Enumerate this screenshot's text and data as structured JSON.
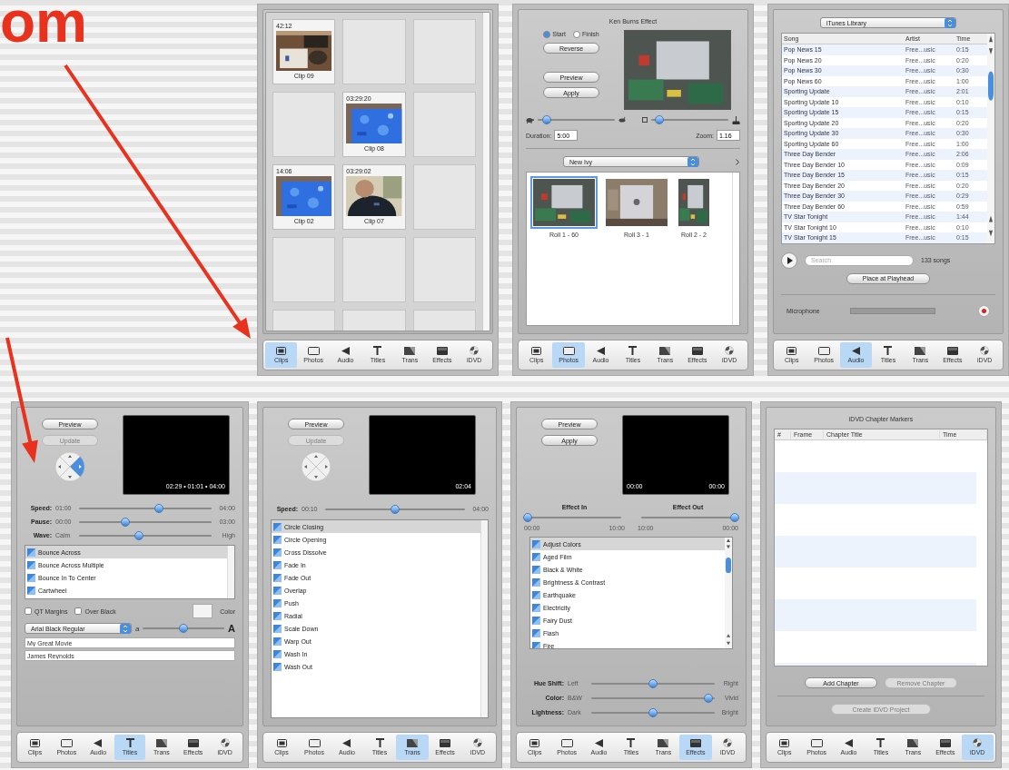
{
  "heading": "om",
  "panels": [
    {
      "kind": "clips",
      "cells": [
        {
          "kind": "clip",
          "time": "42:12",
          "name": "Clip 09"
        },
        {
          "kind": "empty"
        },
        {
          "kind": "empty"
        },
        {
          "kind": "empty"
        },
        {
          "kind": "clip",
          "time": "03:29:20",
          "name": "Clip 08"
        },
        {
          "kind": "empty"
        },
        {
          "kind": "clip",
          "time": "14:06",
          "name": "Clip 02"
        },
        {
          "kind": "clip",
          "time": "03:29:02",
          "name": "Clip 07"
        },
        {
          "kind": "empty"
        },
        {
          "kind": "empty"
        },
        {
          "kind": "empty"
        },
        {
          "kind": "empty"
        },
        {
          "kind": "empty"
        },
        {
          "kind": "empty"
        },
        {
          "kind": "empty"
        }
      ],
      "toolbar": [
        {
          "label": "Clips",
          "selected": true
        },
        {
          "label": "Photos",
          "selected": false
        },
        {
          "label": "Audio",
          "selected": false
        },
        {
          "label": "Titles",
          "selected": false
        },
        {
          "label": "Trans",
          "selected": false
        },
        {
          "label": "Effects",
          "selected": false
        },
        {
          "label": "iDVD",
          "selected": false
        }
      ]
    },
    {
      "kind": "photos",
      "title": "Ken Burns Effect",
      "radios": [
        {
          "label": "Start",
          "selected": true
        },
        {
          "label": "Finish",
          "selected": false
        }
      ],
      "buttons": [
        {
          "label": "Reverse",
          "disabled": false
        },
        {
          "label": "Preview",
          "disabled": false
        },
        {
          "label": "Apply",
          "disabled": false
        }
      ],
      "sliders": [
        {
          "level": 0.12
        },
        {
          "level": 0.1
        }
      ],
      "fields": [
        {
          "label": "Duration:",
          "value": "5:00"
        },
        {
          "label": "Zoom:",
          "value": "1.16"
        }
      ],
      "album": "New Ivy",
      "photos": [
        {
          "name": "Roll 1 - 60",
          "selected": true
        },
        {
          "name": "Roll 3 - 1",
          "selected": false
        },
        {
          "name": "Roll 2 - 2",
          "selected": false
        }
      ],
      "toolbar": [
        {
          "label": "Clips",
          "selected": false
        },
        {
          "label": "Photos",
          "selected": true
        },
        {
          "label": "Audio",
          "selected": false
        },
        {
          "label": "Titles",
          "selected": false
        },
        {
          "label": "Trans",
          "selected": false
        },
        {
          "label": "Effects",
          "selected": false
        },
        {
          "label": "iDVD",
          "selected": false
        }
      ]
    },
    {
      "kind": "audio",
      "source": "iTunes Library",
      "columns": [
        "Song",
        "Artist",
        "Time"
      ],
      "rows": [
        {
          "song": "Pop News 15",
          "artist": "Free...usic",
          "time": "0:15"
        },
        {
          "song": "Pop News 20",
          "artist": "Free...usic",
          "time": "0:20"
        },
        {
          "song": "Pop News 30",
          "artist": "Free...usic",
          "time": "0:30"
        },
        {
          "song": "Pop News 60",
          "artist": "Free...usic",
          "time": "1:00"
        },
        {
          "song": "Sporting Update",
          "artist": "Free...usic",
          "time": "2:01"
        },
        {
          "song": "Sporting Update 10",
          "artist": "Free...usic",
          "time": "0:10"
        },
        {
          "song": "Sporting Update 15",
          "artist": "Free...usic",
          "time": "0:15"
        },
        {
          "song": "Sporting Update 20",
          "artist": "Free...usic",
          "time": "0:20"
        },
        {
          "song": "Sporting Update 30",
          "artist": "Free...usic",
          "time": "0:30"
        },
        {
          "song": "Sporting Update 60",
          "artist": "Free...usic",
          "time": "1:00"
        },
        {
          "song": "Three Day Bender",
          "artist": "Free...usic",
          "time": "2:06"
        },
        {
          "song": "Three Day Bender 10",
          "artist": "Free...usic",
          "time": "0:09"
        },
        {
          "song": "Three Day Bender 15",
          "artist": "Free...usic",
          "time": "0:15"
        },
        {
          "song": "Three Day Bender 20",
          "artist": "Free...usic",
          "time": "0:20"
        },
        {
          "song": "Three Day Bender 30",
          "artist": "Free...usic",
          "time": "0:29"
        },
        {
          "song": "Three Day Bender 60",
          "artist": "Free...usic",
          "time": "0:59"
        },
        {
          "song": "TV Star Tonight",
          "artist": "Free...usic",
          "time": "1:44"
        },
        {
          "song": "TV Star Tonight 10",
          "artist": "Free...usic",
          "time": "0:10"
        },
        {
          "song": "TV Star Tonight 15",
          "artist": "Free...usic",
          "time": "0:15"
        }
      ],
      "search": {
        "placeholder": "Search"
      },
      "count": "133 songs",
      "button": "Place at Playhead",
      "mic_label": "Microphone",
      "toolbar": [
        {
          "label": "Clips",
          "selected": false
        },
        {
          "label": "Photos",
          "selected": false
        },
        {
          "label": "Audio",
          "selected": true
        },
        {
          "label": "Titles",
          "selected": false
        },
        {
          "label": "Trans",
          "selected": false
        },
        {
          "label": "Effects",
          "selected": false
        },
        {
          "label": "iDVD",
          "selected": false
        }
      ]
    },
    {
      "kind": "titles",
      "buttons": [
        {
          "label": "Preview",
          "disabled": false
        },
        {
          "label": "Update",
          "disabled": true
        }
      ],
      "wheel": [
        {
          "selected": false
        },
        {
          "selected": true
        },
        {
          "selected": false
        },
        {
          "selected": false
        }
      ],
      "preview_time": "02:29 • 01:01 • 04:00",
      "sliders": [
        {
          "label": "Speed:",
          "min": "01:00",
          "max": "04:00",
          "level": 0.6
        },
        {
          "label": "Pause:",
          "min": "00:00",
          "max": "03:00",
          "level": 0.35
        },
        {
          "label": "Wave:",
          "min": "Calm",
          "max": "High",
          "level": 0.45
        }
      ],
      "items": [
        {
          "label": "Bounce Across",
          "selected": true
        },
        {
          "label": "Bounce Across Multiple",
          "selected": false
        },
        {
          "label": "Bounce In To Center",
          "selected": false
        },
        {
          "label": "Cartwheel",
          "selected": false
        }
      ],
      "options": [
        {
          "label": "QT Margins",
          "checked": false
        },
        {
          "label": "Over Black",
          "checked": false
        }
      ],
      "color_label": "Color",
      "font": "Arial Black Regular",
      "size_slider": {
        "min": "a",
        "max": "A",
        "level": 0.5
      },
      "texts": [
        "My Great Movie",
        "James Reynolds"
      ],
      "toolbar": [
        {
          "label": "Clips",
          "selected": false
        },
        {
          "label": "Photos",
          "selected": false
        },
        {
          "label": "Audio",
          "selected": false
        },
        {
          "label": "Titles",
          "selected": true
        },
        {
          "label": "Trans",
          "selected": false
        },
        {
          "label": "Effects",
          "selected": false
        },
        {
          "label": "iDVD",
          "selected": false
        }
      ]
    },
    {
      "kind": "trans",
      "buttons": [
        {
          "label": "Preview",
          "disabled": false
        },
        {
          "label": "Update",
          "disabled": true
        }
      ],
      "wheel": [
        {
          "selected": false
        },
        {
          "selected": false
        },
        {
          "selected": false
        },
        {
          "selected": false
        }
      ],
      "preview_time": "02:04",
      "sliders": [
        {
          "label": "Speed:",
          "min": "00:10",
          "max": "04:00",
          "level": 0.5
        }
      ],
      "items": [
        {
          "label": "Circle Closing",
          "selected": true
        },
        {
          "label": "Circle Opening",
          "selected": false
        },
        {
          "label": "Cross Dissolve",
          "selected": false
        },
        {
          "label": "Fade In",
          "selected": false
        },
        {
          "label": "Fade Out",
          "selected": false
        },
        {
          "label": "Overlap",
          "selected": false
        },
        {
          "label": "Push",
          "selected": false
        },
        {
          "label": "Radial",
          "selected": false
        },
        {
          "label": "Scale Down",
          "selected": false
        },
        {
          "label": "Warp Out",
          "selected": false
        },
        {
          "label": "Wash In",
          "selected": false
        },
        {
          "label": "Wash Out",
          "selected": false
        }
      ],
      "toolbar": [
        {
          "label": "Clips",
          "selected": false
        },
        {
          "label": "Photos",
          "selected": false
        },
        {
          "label": "Audio",
          "selected": false
        },
        {
          "label": "Titles",
          "selected": false
        },
        {
          "label": "Trans",
          "selected": true
        },
        {
          "label": "Effects",
          "selected": false
        },
        {
          "label": "iDVD",
          "selected": false
        }
      ]
    },
    {
      "kind": "effects",
      "buttons": [
        {
          "label": "Preview",
          "disabled": false
        },
        {
          "label": "Apply",
          "disabled": false
        }
      ],
      "preview_times": [
        "00:00",
        "00:00"
      ],
      "effect_sliders": [
        {
          "label": "Effect In",
          "min": "00:00",
          "max": "10:00",
          "level": 0
        },
        {
          "label": "Effect Out",
          "min": "10:00",
          "max": "00:00",
          "level": 1
        }
      ],
      "items": [
        {
          "label": "Adjust Colors",
          "selected": true
        },
        {
          "label": "Aged Film",
          "selected": false
        },
        {
          "label": "Black & White",
          "selected": false
        },
        {
          "label": "Brightness & Contrast",
          "selected": false
        },
        {
          "label": "Earthquake",
          "selected": false
        },
        {
          "label": "Electricity",
          "selected": false
        },
        {
          "label": "Fairy Dust",
          "selected": false
        },
        {
          "label": "Flash",
          "selected": false
        },
        {
          "label": "Fire",
          "selected": false
        }
      ],
      "sliders": [
        {
          "label": "Hue Shift:",
          "min": "Left",
          "max": "Right",
          "level": 0.5
        },
        {
          "label": "Color:",
          "min": "B&W",
          "max": "Vivid",
          "level": 0.95
        },
        {
          "label": "Lightness:",
          "min": "Dark",
          "max": "Bright",
          "level": 0.5
        }
      ],
      "toolbar": [
        {
          "label": "Clips",
          "selected": false
        },
        {
          "label": "Photos",
          "selected": false
        },
        {
          "label": "Audio",
          "selected": false
        },
        {
          "label": "Titles",
          "selected": false
        },
        {
          "label": "Trans",
          "selected": false
        },
        {
          "label": "Effects",
          "selected": true
        },
        {
          "label": "iDVD",
          "selected": false
        }
      ]
    },
    {
      "kind": "idvd",
      "title": "iDVD Chapter Markers",
      "columns": [
        "#",
        "Frame",
        "Chapter Title",
        "Time"
      ],
      "buttons": [
        {
          "label": "Add Chapter",
          "disabled": false
        },
        {
          "label": "Remove Chapter",
          "disabled": true
        }
      ],
      "create": {
        "label": "Create iDVD Project",
        "disabled": true
      },
      "toolbar": [
        {
          "label": "Clips",
          "selected": false
        },
        {
          "label": "Photos",
          "selected": false
        },
        {
          "label": "Audio",
          "selected": false
        },
        {
          "label": "Titles",
          "selected": false
        },
        {
          "label": "Trans",
          "selected": false
        },
        {
          "label": "Effects",
          "selected": false
        },
        {
          "label": "iDVD",
          "selected": true
        }
      ]
    }
  ]
}
